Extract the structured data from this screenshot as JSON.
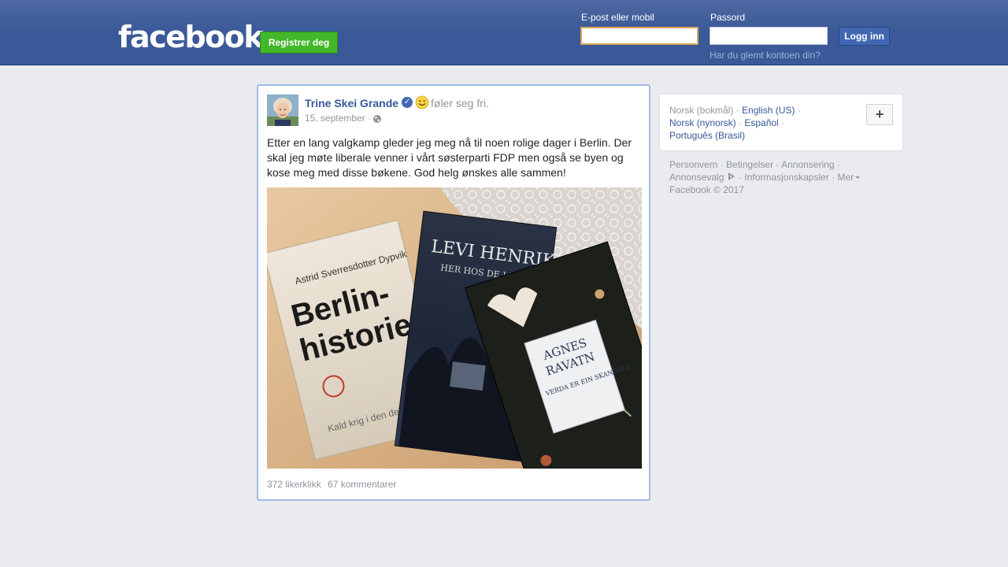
{
  "header": {
    "logo_text": "facebook",
    "register_label": "Registrer deg",
    "email_label": "E-post eller mobil",
    "email_value": "",
    "password_label": "Passord",
    "password_value": "",
    "login_label": "Logg inn",
    "forgot_label": "Har du glemt kontoen din?"
  },
  "post": {
    "author": "Trine Skei Grande",
    "feeling": "føler seg fri.",
    "date": "15. september ·",
    "text": "Etter en lang valgkamp gleder jeg meg nå til noen rolige dager i Berlin. Der skal jeg møte liberale venner i vårt søsterparti FDP men også se byen og kose meg med disse bøkene. God helg ønskes alle sammen!",
    "photo_books": {
      "book1_author": "Astrid Sverresdotter Dypvik",
      "book1_title_a": "Berlin-",
      "book1_title_b": "historie",
      "book1_subtitle": "Kald krig i den delte",
      "book2_author": "LEVI HENRIKS",
      "book2_title": "HER HOS DE LEVEN",
      "book3_author_a": "AGNES",
      "book3_author_b": "RAVATN",
      "book3_title": "VERDA ER EIN SKANDALE"
    },
    "likes": "372 likerklikk",
    "comments": "67 kommentarer"
  },
  "sidebar": {
    "lang_current": "Norsk (bokmål) · ",
    "lang_english": "English (US)",
    "sep1": " · ",
    "lang_nynorsk": "Norsk (nynorsk)",
    "sep2": " · ",
    "lang_spanish": "Español",
    "sep3": " · ",
    "lang_portuguese": "Português (Brasil)",
    "add_label": "+"
  },
  "footer": {
    "privacy": "Personvern",
    "terms": "Betingelser",
    "advertising": "Annonsering",
    "adchoices": "Annonsevalg",
    "cookies": "Informasjonskapsler",
    "more": "Mer",
    "copyright": "Facebook © 2017",
    "dot": " · "
  },
  "colors": {
    "brand_blue": "#3b5998",
    "register_green": "#42b72a",
    "link_blue": "#365899"
  }
}
